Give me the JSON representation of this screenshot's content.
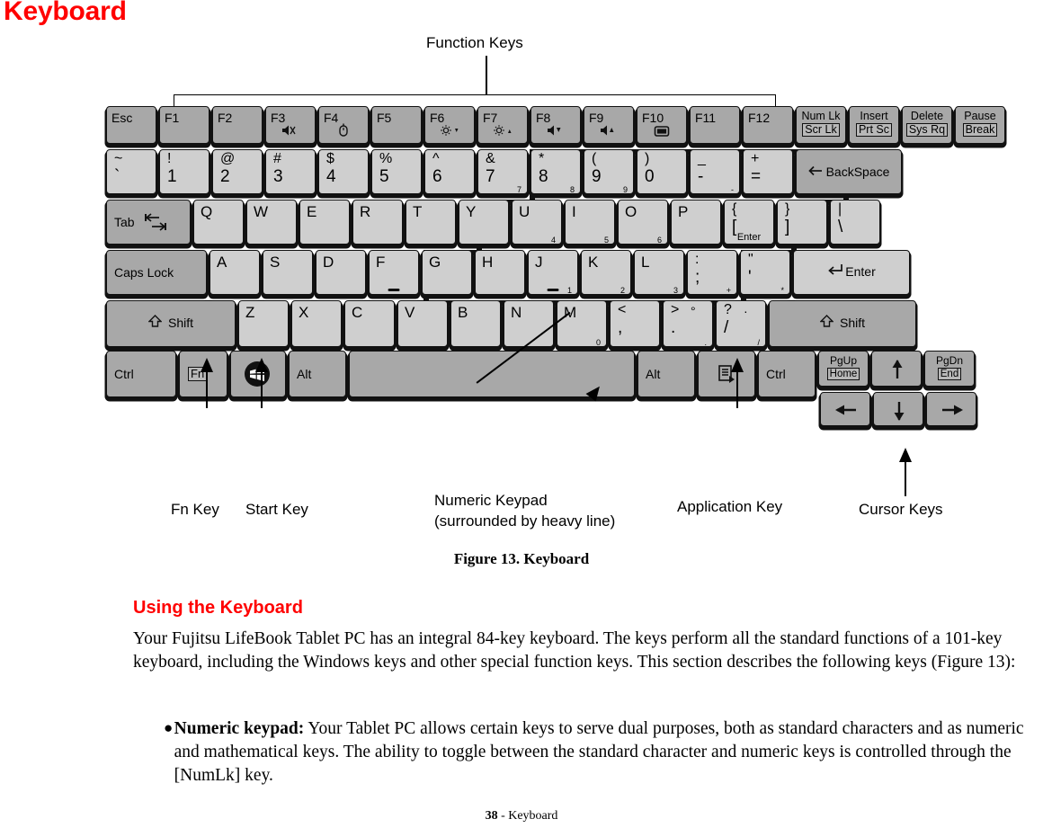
{
  "page": {
    "title": "Keyboard",
    "footer_page": "38",
    "footer_text": " - Keyboard"
  },
  "figure": {
    "caption": "Figure 13.  Keyboard",
    "annotations": {
      "function_keys": "Function Keys",
      "fn_key": "Fn Key",
      "start_key": "Start Key",
      "numeric_keypad_line1": "Numeric Keypad",
      "numeric_keypad_line2": "(surrounded by heavy line)",
      "application_key": "Application Key",
      "cursor_keys": "Cursor Keys"
    }
  },
  "keyboard": {
    "function_row": [
      {
        "label": "Esc",
        "symbol": ""
      },
      {
        "label": "F1",
        "symbol": ""
      },
      {
        "label": "F2",
        "symbol": ""
      },
      {
        "label": "F3",
        "symbol": "mute-icon"
      },
      {
        "label": "F4",
        "symbol": "mouse-icon"
      },
      {
        "label": "F5",
        "symbol": ""
      },
      {
        "label": "F6",
        "symbol": "brightness-down-icon"
      },
      {
        "label": "F7",
        "symbol": "brightness-up-icon"
      },
      {
        "label": "F8",
        "symbol": "volume-down-icon"
      },
      {
        "label": "F9",
        "symbol": "volume-up-icon"
      },
      {
        "label": "F10",
        "symbol": "display-icon"
      },
      {
        "label": "F11",
        "symbol": ""
      },
      {
        "label": "F12",
        "symbol": ""
      }
    ],
    "function_row_right": [
      {
        "top": "Num Lk",
        "bottom": "Scr Lk"
      },
      {
        "top": "Insert",
        "bottom": "Prt Sc"
      },
      {
        "top": "Delete",
        "bottom": "Sys Rq"
      },
      {
        "top": "Pause",
        "bottom": "Break"
      }
    ],
    "number_row": [
      {
        "top": "~",
        "bottom": "`",
        "keypad": ""
      },
      {
        "top": "!",
        "bottom": "1",
        "keypad": ""
      },
      {
        "top": "@",
        "bottom": "2",
        "keypad": ""
      },
      {
        "top": "#",
        "bottom": "3",
        "keypad": ""
      },
      {
        "top": "$",
        "bottom": "4",
        "keypad": ""
      },
      {
        "top": "%",
        "bottom": "5",
        "keypad": ""
      },
      {
        "top": "^",
        "bottom": "6",
        "keypad": ""
      },
      {
        "top": "&",
        "bottom": "7",
        "keypad": "7"
      },
      {
        "top": "*",
        "bottom": "8",
        "keypad": "8"
      },
      {
        "top": "(",
        "bottom": "9",
        "keypad": "9"
      },
      {
        "top": ")",
        "bottom": "0",
        "keypad": ""
      },
      {
        "top": "_",
        "bottom": "-",
        "keypad": "-"
      },
      {
        "top": "+",
        "bottom": "=",
        "keypad": ""
      }
    ],
    "backspace": "BackSpace",
    "qwerty_row": [
      {
        "label": "Q",
        "keypad": ""
      },
      {
        "label": "W",
        "keypad": ""
      },
      {
        "label": "E",
        "keypad": ""
      },
      {
        "label": "R",
        "keypad": ""
      },
      {
        "label": "T",
        "keypad": ""
      },
      {
        "label": "Y",
        "keypad": ""
      },
      {
        "label": "U",
        "keypad": "4"
      },
      {
        "label": "I",
        "keypad": "5"
      },
      {
        "label": "O",
        "keypad": "6"
      },
      {
        "label": "P",
        "keypad": ""
      }
    ],
    "qwerty_right": [
      {
        "top": "{",
        "bottom": "[",
        "keypad": "Enter"
      },
      {
        "top": "}",
        "bottom": "]",
        "keypad": ""
      },
      {
        "top": "|",
        "bottom": "\\",
        "keypad": ""
      }
    ],
    "tab": "Tab",
    "caps_lock": "Caps Lock",
    "home_row": [
      {
        "label": "A",
        "keypad": ""
      },
      {
        "label": "S",
        "keypad": ""
      },
      {
        "label": "D",
        "keypad": ""
      },
      {
        "label": "F",
        "keypad": "",
        "homing": true
      },
      {
        "label": "G",
        "keypad": ""
      },
      {
        "label": "H",
        "keypad": ""
      },
      {
        "label": "J",
        "keypad": "1",
        "homing": true
      },
      {
        "label": "K",
        "keypad": "2"
      },
      {
        "label": "L",
        "keypad": "3"
      }
    ],
    "home_row_right": [
      {
        "top": ":",
        "bottom": ";",
        "keypad": "+"
      },
      {
        "top": "\"",
        "bottom": "'",
        "keypad": "*"
      }
    ],
    "enter": "Enter",
    "shift_left": "Shift",
    "shift_right": "Shift",
    "zxcv_row": [
      {
        "label": "Z",
        "keypad": ""
      },
      {
        "label": "X",
        "keypad": ""
      },
      {
        "label": "C",
        "keypad": ""
      },
      {
        "label": "V",
        "keypad": ""
      },
      {
        "label": "B",
        "keypad": ""
      },
      {
        "label": "N",
        "keypad": ""
      },
      {
        "label": "M",
        "keypad": "0"
      }
    ],
    "zxcv_right": [
      {
        "top": "<",
        "bottom": ",",
        "keypad": "",
        "extra": ""
      },
      {
        "top": ">",
        "bottom": ".",
        "keypad": ".",
        "extra": "°"
      },
      {
        "top": "?",
        "bottom": "/",
        "keypad": "/",
        "extra": "·"
      }
    ],
    "bottom_row": {
      "ctrl_left": "Ctrl",
      "fn": "Fn",
      "start": "start-windows-icon",
      "alt_left": "Alt",
      "space": "",
      "alt_right": "Alt",
      "application": "application-menu-icon",
      "ctrl_right": "Ctrl"
    },
    "nav_cluster": [
      {
        "top": "PgUp",
        "bottom": "Home"
      },
      {
        "top": "PgDn",
        "bottom": "End"
      }
    ],
    "arrows": {
      "up": "↑",
      "down": "↓",
      "left": "←",
      "right": "→"
    }
  },
  "content": {
    "section_heading": "Using the Keyboard",
    "paragraph": "Your Fujitsu LifeBook Tablet PC has an integral 84-key keyboard. The keys perform all the standard functions of a 101-key keyboard, including the Windows keys and other special function keys. This section describes the following keys (Figure 13):",
    "bullet_label": "Numeric keypad:",
    "bullet_text": " Your Tablet PC allows certain keys to serve dual purposes, both as standard characters and as numeric and mathematical keys. The ability to toggle between the standard character and numeric keys is controlled through the [NumLk] key."
  },
  "colors": {
    "accent_red": "#ff0000",
    "key_face": "#cfcfcf",
    "key_face_dark": "#a8a8a8",
    "key_border": "#111111"
  }
}
